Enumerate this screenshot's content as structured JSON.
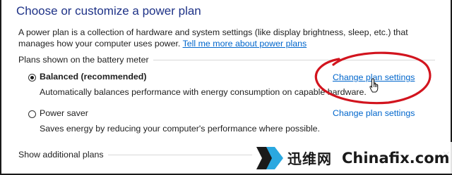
{
  "page": {
    "title": "Choose or customize a power plan",
    "description": "A power plan is a collection of hardware and system settings (like display brightness, sleep, etc.) that manages how your computer uses power.",
    "learn_more_link": "Tell me more about power plans"
  },
  "plans_group": {
    "label": "Plans shown on the battery meter",
    "plans": [
      {
        "name": "Balanced (recommended)",
        "selected": true,
        "description": "Automatically balances performance with energy consumption on capable hardware.",
        "change_link": "Change plan settings"
      },
      {
        "name": "Power saver",
        "selected": false,
        "description": "Saves energy by reducing your computer's performance where possible.",
        "change_link": "Change plan settings"
      }
    ]
  },
  "additional": {
    "label": "Show additional plans",
    "icon": "chevron-down-icon"
  },
  "annotation": {
    "shape": "ellipse",
    "color": "#d2141e",
    "cursor_icon": "hand-pointer-icon"
  },
  "watermark": {
    "cn": "迅维网",
    "en": "Chinafix.com",
    "logo_icon": "arrow-logo-icon"
  },
  "colors": {
    "title": "#1e3287",
    "link": "#0066cc"
  }
}
